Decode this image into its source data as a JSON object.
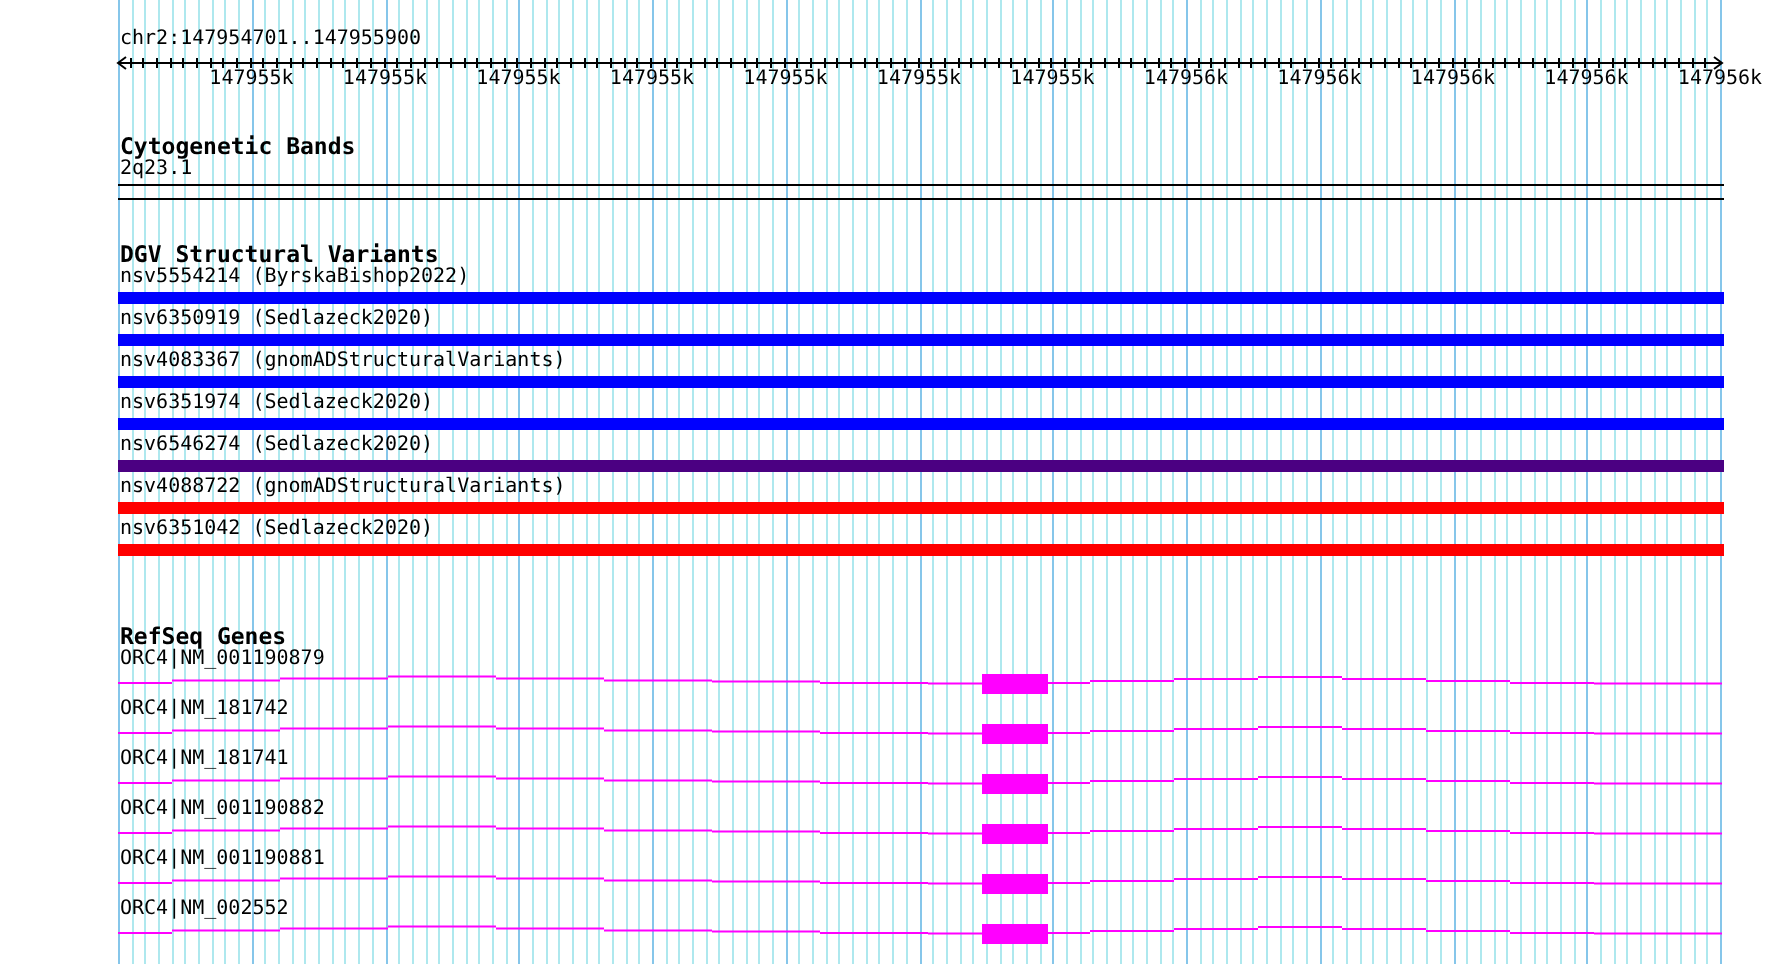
{
  "location": "chr2:147954701..147955900",
  "ruler": {
    "ticks": [
      "147955k",
      "147955k",
      "147955k",
      "147955k",
      "147955k",
      "147955k",
      "147955k",
      "147956k",
      "147956k",
      "147956k",
      "147956k",
      "147956k"
    ]
  },
  "tracks": [
    {
      "kind": "cytoband",
      "title": "Cytogenetic Bands",
      "features": [
        {
          "label": "2q23.1"
        }
      ]
    },
    {
      "kind": "variants",
      "title": "DGV Structural Variants",
      "features": [
        {
          "label": "nsv5554214 (ByrskaBishop2022)",
          "color": "#0000ff"
        },
        {
          "label": "nsv6350919 (Sedlazeck2020)",
          "color": "#0000ff"
        },
        {
          "label": "nsv4083367 (gnomADStructuralVariants)",
          "color": "#0000ff"
        },
        {
          "label": "nsv6351974 (Sedlazeck2020)",
          "color": "#0000ff"
        },
        {
          "label": "nsv6546274 (Sedlazeck2020)",
          "color": "#4b0082"
        },
        {
          "label": "nsv4088722 (gnomADStructuralVariants)",
          "color": "#ff0000"
        },
        {
          "label": "nsv6351042 (Sedlazeck2020)",
          "color": "#ff0000"
        }
      ]
    },
    {
      "kind": "genes",
      "title": "RefSeq Genes",
      "features": [
        {
          "label": "ORC4|NM_001190879"
        },
        {
          "label": "ORC4|NM_181742"
        },
        {
          "label": "ORC4|NM_181741"
        },
        {
          "label": "ORC4|NM_001190882"
        },
        {
          "label": "ORC4|NM_001190881"
        },
        {
          "label": "ORC4|NM_002552"
        }
      ]
    }
  ]
}
